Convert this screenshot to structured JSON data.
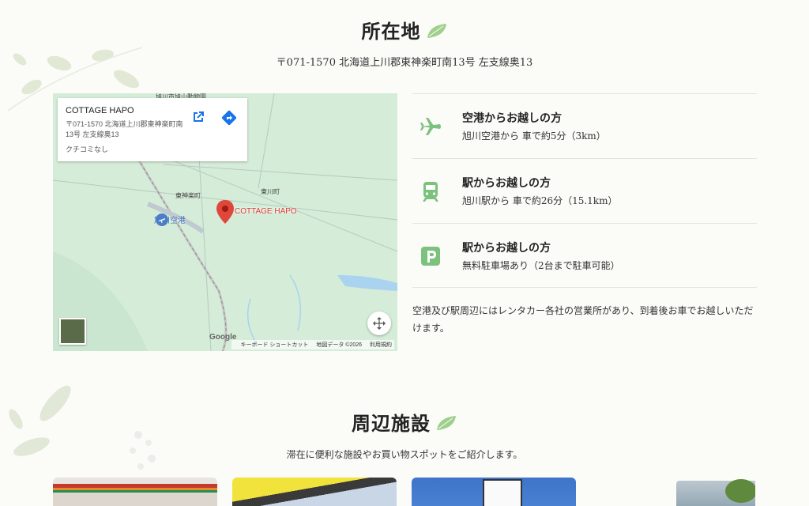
{
  "location": {
    "title": "所在地",
    "address": "〒071-1570 北海道上川郡東神楽町南13号 左支線奥13"
  },
  "map": {
    "card": {
      "name": "COTTAGE HAPO",
      "address": "〒071-1570 北海道上川郡東神楽町南13号 左支線奥13",
      "reviews": "クチコミなし"
    },
    "pin_label": "COTTAGE HAPO",
    "airport_label": "旭川空港",
    "place_labels": [
      "東神楽町",
      "東川町",
      "旭川市旭山動物園"
    ],
    "logo": "Google",
    "footer": [
      "キーボード ショートカット",
      "地図データ ©2026",
      "利用規約"
    ]
  },
  "access": [
    {
      "icon": "airplane-icon",
      "title": "空港からお越しの方",
      "desc": "旭川空港から 車で約5分（3km）"
    },
    {
      "icon": "train-icon",
      "title": "駅からお越しの方",
      "desc": "旭川駅から 車で約26分（15.1km）"
    },
    {
      "icon": "parking-icon",
      "title": "駅からお越しの方",
      "desc": "無料駐車場あり（2台まで駐車可能）"
    }
  ],
  "access_note": "空港及び駅周辺にはレンタカー各社の営業所があり、到着後お車でお越しいただけます。",
  "facilities": {
    "title": "周辺施設",
    "subtitle": "滞在に便利な施設やお買い物スポットをご紹介します。"
  },
  "colors": {
    "accent_green": "#7cc27e",
    "pin_red": "#d63a2f",
    "map_green": "#cfe8d4"
  }
}
